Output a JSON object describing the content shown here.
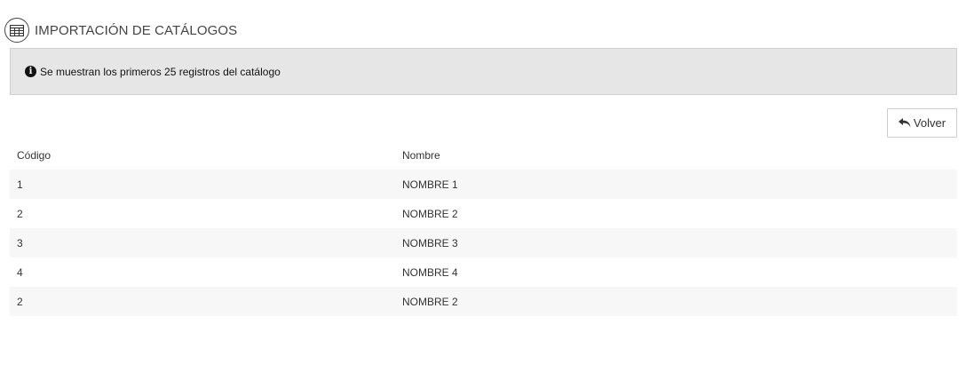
{
  "header": {
    "icon": "table-icon",
    "title": "IMPORTACIÓN DE CATÁLOGOS"
  },
  "info": {
    "icon": "info-circle-icon",
    "text": "Se muestran los primeros 25 registros del catálogo"
  },
  "actions": {
    "back_label": "Volver",
    "back_icon": "undo-icon"
  },
  "table": {
    "columns": [
      "Código",
      "Nombre"
    ],
    "rows": [
      {
        "codigo": "1",
        "nombre": "NOMBRE 1"
      },
      {
        "codigo": "2",
        "nombre": "NOMBRE 2"
      },
      {
        "codigo": "3",
        "nombre": "NOMBRE 3"
      },
      {
        "codigo": "4",
        "nombre": "NOMBRE 4"
      },
      {
        "codigo": "2",
        "nombre": "NOMBRE 2"
      }
    ]
  },
  "colors": {
    "info_background": "#e6e6e6",
    "row_stripe": "#f7f7f7",
    "text": "#333333"
  }
}
